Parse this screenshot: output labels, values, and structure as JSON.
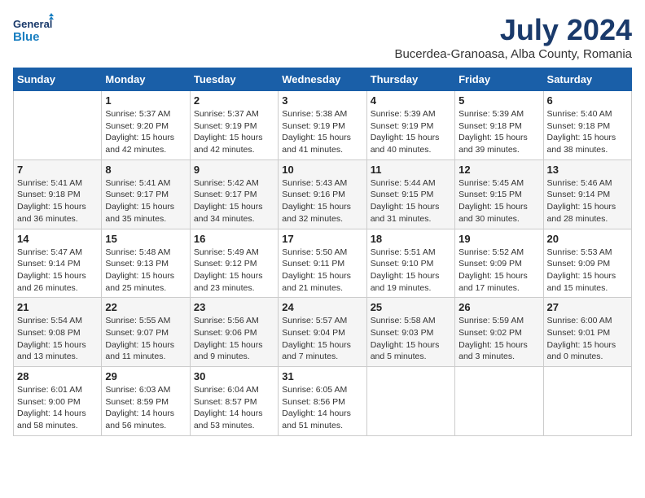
{
  "logo": {
    "line1": "General",
    "line2": "Blue"
  },
  "title": "July 2024",
  "subtitle": "Bucerdea-Granoasa, Alba County, Romania",
  "weekdays": [
    "Sunday",
    "Monday",
    "Tuesday",
    "Wednesday",
    "Thursday",
    "Friday",
    "Saturday"
  ],
  "weeks": [
    [
      {
        "day": "",
        "info": ""
      },
      {
        "day": "1",
        "info": "Sunrise: 5:37 AM\nSunset: 9:20 PM\nDaylight: 15 hours\nand 42 minutes."
      },
      {
        "day": "2",
        "info": "Sunrise: 5:37 AM\nSunset: 9:19 PM\nDaylight: 15 hours\nand 42 minutes."
      },
      {
        "day": "3",
        "info": "Sunrise: 5:38 AM\nSunset: 9:19 PM\nDaylight: 15 hours\nand 41 minutes."
      },
      {
        "day": "4",
        "info": "Sunrise: 5:39 AM\nSunset: 9:19 PM\nDaylight: 15 hours\nand 40 minutes."
      },
      {
        "day": "5",
        "info": "Sunrise: 5:39 AM\nSunset: 9:18 PM\nDaylight: 15 hours\nand 39 minutes."
      },
      {
        "day": "6",
        "info": "Sunrise: 5:40 AM\nSunset: 9:18 PM\nDaylight: 15 hours\nand 38 minutes."
      }
    ],
    [
      {
        "day": "7",
        "info": "Sunrise: 5:41 AM\nSunset: 9:18 PM\nDaylight: 15 hours\nand 36 minutes."
      },
      {
        "day": "8",
        "info": "Sunrise: 5:41 AM\nSunset: 9:17 PM\nDaylight: 15 hours\nand 35 minutes."
      },
      {
        "day": "9",
        "info": "Sunrise: 5:42 AM\nSunset: 9:17 PM\nDaylight: 15 hours\nand 34 minutes."
      },
      {
        "day": "10",
        "info": "Sunrise: 5:43 AM\nSunset: 9:16 PM\nDaylight: 15 hours\nand 32 minutes."
      },
      {
        "day": "11",
        "info": "Sunrise: 5:44 AM\nSunset: 9:15 PM\nDaylight: 15 hours\nand 31 minutes."
      },
      {
        "day": "12",
        "info": "Sunrise: 5:45 AM\nSunset: 9:15 PM\nDaylight: 15 hours\nand 30 minutes."
      },
      {
        "day": "13",
        "info": "Sunrise: 5:46 AM\nSunset: 9:14 PM\nDaylight: 15 hours\nand 28 minutes."
      }
    ],
    [
      {
        "day": "14",
        "info": "Sunrise: 5:47 AM\nSunset: 9:14 PM\nDaylight: 15 hours\nand 26 minutes."
      },
      {
        "day": "15",
        "info": "Sunrise: 5:48 AM\nSunset: 9:13 PM\nDaylight: 15 hours\nand 25 minutes."
      },
      {
        "day": "16",
        "info": "Sunrise: 5:49 AM\nSunset: 9:12 PM\nDaylight: 15 hours\nand 23 minutes."
      },
      {
        "day": "17",
        "info": "Sunrise: 5:50 AM\nSunset: 9:11 PM\nDaylight: 15 hours\nand 21 minutes."
      },
      {
        "day": "18",
        "info": "Sunrise: 5:51 AM\nSunset: 9:10 PM\nDaylight: 15 hours\nand 19 minutes."
      },
      {
        "day": "19",
        "info": "Sunrise: 5:52 AM\nSunset: 9:09 PM\nDaylight: 15 hours\nand 17 minutes."
      },
      {
        "day": "20",
        "info": "Sunrise: 5:53 AM\nSunset: 9:09 PM\nDaylight: 15 hours\nand 15 minutes."
      }
    ],
    [
      {
        "day": "21",
        "info": "Sunrise: 5:54 AM\nSunset: 9:08 PM\nDaylight: 15 hours\nand 13 minutes."
      },
      {
        "day": "22",
        "info": "Sunrise: 5:55 AM\nSunset: 9:07 PM\nDaylight: 15 hours\nand 11 minutes."
      },
      {
        "day": "23",
        "info": "Sunrise: 5:56 AM\nSunset: 9:06 PM\nDaylight: 15 hours\nand 9 minutes."
      },
      {
        "day": "24",
        "info": "Sunrise: 5:57 AM\nSunset: 9:04 PM\nDaylight: 15 hours\nand 7 minutes."
      },
      {
        "day": "25",
        "info": "Sunrise: 5:58 AM\nSunset: 9:03 PM\nDaylight: 15 hours\nand 5 minutes."
      },
      {
        "day": "26",
        "info": "Sunrise: 5:59 AM\nSunset: 9:02 PM\nDaylight: 15 hours\nand 3 minutes."
      },
      {
        "day": "27",
        "info": "Sunrise: 6:00 AM\nSunset: 9:01 PM\nDaylight: 15 hours\nand 0 minutes."
      }
    ],
    [
      {
        "day": "28",
        "info": "Sunrise: 6:01 AM\nSunset: 9:00 PM\nDaylight: 14 hours\nand 58 minutes."
      },
      {
        "day": "29",
        "info": "Sunrise: 6:03 AM\nSunset: 8:59 PM\nDaylight: 14 hours\nand 56 minutes."
      },
      {
        "day": "30",
        "info": "Sunrise: 6:04 AM\nSunset: 8:57 PM\nDaylight: 14 hours\nand 53 minutes."
      },
      {
        "day": "31",
        "info": "Sunrise: 6:05 AM\nSunset: 8:56 PM\nDaylight: 14 hours\nand 51 minutes."
      },
      {
        "day": "",
        "info": ""
      },
      {
        "day": "",
        "info": ""
      },
      {
        "day": "",
        "info": ""
      }
    ]
  ]
}
